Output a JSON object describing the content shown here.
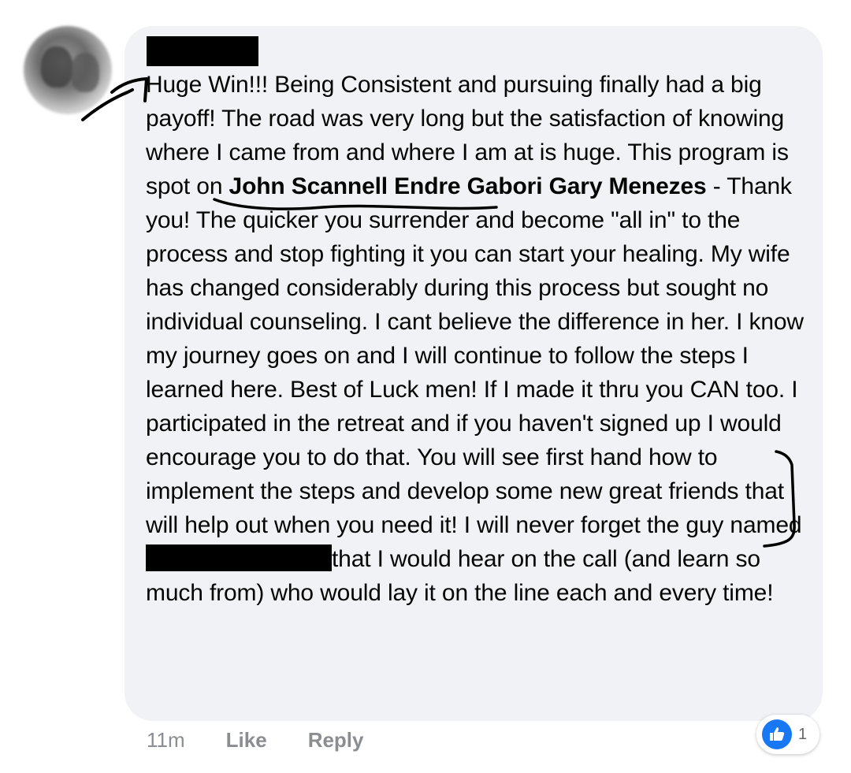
{
  "comment": {
    "parts": {
      "intro": "Huge Win!!! Being Consistent and pursuing finally had a big payoff! The road was very long but the satisfaction of knowing where I came from and where I am at is huge. ",
      "underlined": "This program is spot on",
      "space": " ",
      "tagged_names": "John Scannell Endre Gabori Gary Menezes",
      "middle": " - Thank you!  The quicker you surrender and become \"all in\" to the process and stop fighting it you can start your healing. My wife has changed considerably during this process but sought no individual counseling. I cant believe the difference in her. I know  my journey goes on and I will continue to follow the steps I learned here. Best of Luck men!  If I made it thru you CAN too. I participated in the retreat and if you haven't signed up I would encourage you to do that. You will see first hand how to implement the steps  and develop some new great friends that will help out when you need it! I will never forget the guy named",
      "after_redaction": "that I would hear on the call (and learn so much from) who would lay it on the line each and every time!"
    }
  },
  "footer": {
    "time": "11m",
    "like_label": "Like",
    "reply_label": "Reply"
  },
  "reactions": {
    "icon": "thumbs-up-icon",
    "count": "1",
    "color": "#1877f2"
  },
  "colors": {
    "bubble": "#f0f2f5",
    "meta_text": "#8a8d91"
  }
}
